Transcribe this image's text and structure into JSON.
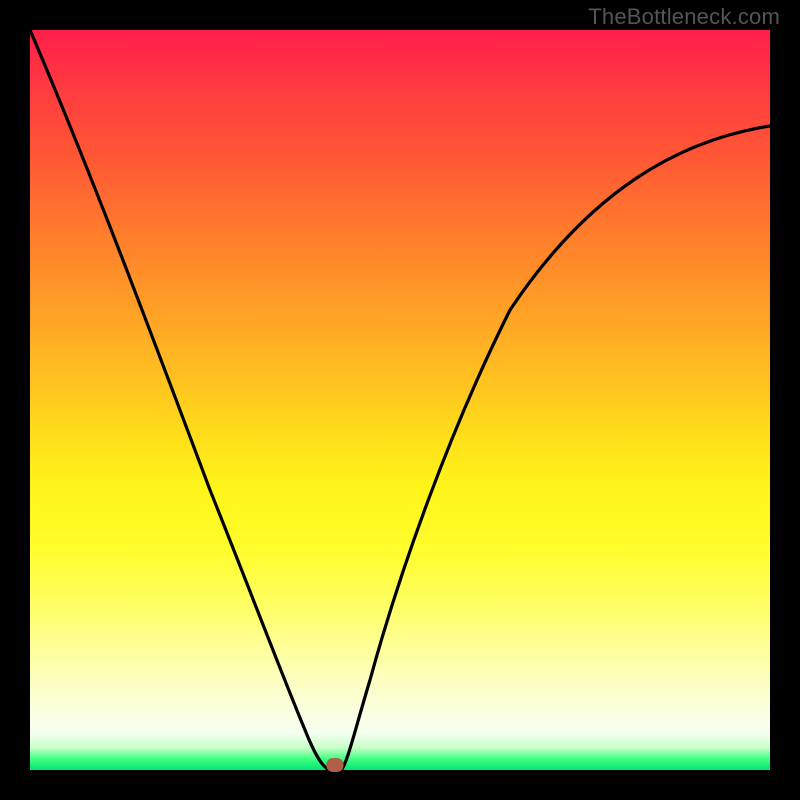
{
  "watermark": {
    "text": "TheBottleneck.com"
  },
  "chart_data": {
    "type": "line",
    "title": "",
    "xlabel": "",
    "ylabel": "",
    "xlim": [
      0,
      100
    ],
    "ylim": [
      0,
      100
    ],
    "grid": false,
    "legend": false,
    "series": [
      {
        "name": "bottleneck-curve",
        "x": [
          0,
          3,
          6,
          9,
          12,
          15,
          18,
          21,
          24,
          27,
          30,
          33,
          35,
          37,
          38,
          39,
          40,
          41,
          42,
          43,
          45,
          48,
          52,
          56,
          60,
          65,
          70,
          75,
          80,
          85,
          90,
          95,
          100
        ],
        "y": [
          100,
          92,
          84,
          76,
          68,
          60,
          52,
          44,
          36,
          28,
          20,
          12,
          7,
          3,
          1,
          0,
          0,
          0,
          1,
          5,
          12,
          22,
          33,
          43,
          51,
          59,
          66,
          71,
          76,
          80,
          83,
          85,
          87
        ]
      }
    ],
    "marker": {
      "x": 41,
      "y": 0,
      "color": "#b06048"
    },
    "background_gradient": {
      "top": "#ff1e4a",
      "mid": "#ffe21a",
      "bottom": "#00e676"
    }
  }
}
